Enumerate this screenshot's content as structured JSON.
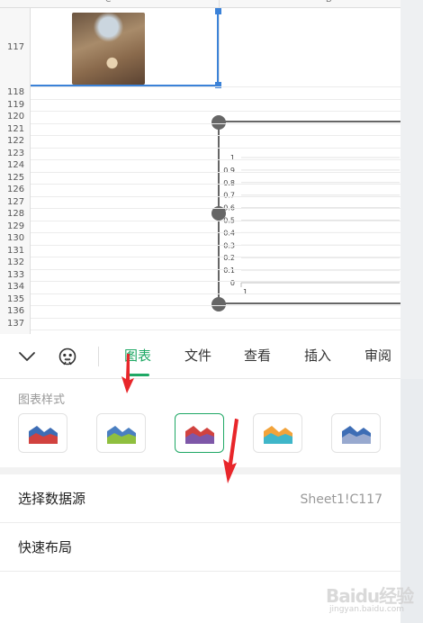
{
  "sheet": {
    "columns": [
      "C",
      "D"
    ],
    "rows": [
      "117",
      "118",
      "119",
      "120",
      "121",
      "122",
      "123",
      "124",
      "125",
      "126",
      "127",
      "128",
      "129",
      "130",
      "131",
      "132",
      "133",
      "134",
      "135",
      "136",
      "137"
    ],
    "selected_cell_image": "interior-photo"
  },
  "chart_preview": {
    "y_tick_labels": [
      "1",
      "0.9",
      "0.8",
      "0.7",
      "0.6",
      "0.5",
      "0.4",
      "0.3",
      "0.2",
      "0.1",
      "0"
    ],
    "x_tick_labels": [
      "1"
    ]
  },
  "toolbar": {
    "collapse_icon": "chevron-down-icon",
    "emoji_icon": "emoji-face-icon",
    "tabs": [
      {
        "label": "图表",
        "active": true
      },
      {
        "label": "文件",
        "active": false
      },
      {
        "label": "查看",
        "active": false
      },
      {
        "label": "插入",
        "active": false
      },
      {
        "label": "审阅",
        "active": false
      }
    ],
    "accent_color": "#1fa865"
  },
  "panel": {
    "section_title": "图表样式",
    "styles": [
      {
        "name": "area-style-1",
        "colors": [
          "#3d6db5",
          "#d1423f"
        ],
        "selected": false
      },
      {
        "name": "area-style-2",
        "colors": [
          "#4a7fc1",
          "#8fbf3f"
        ],
        "selected": false
      },
      {
        "name": "area-style-3",
        "colors": [
          "#d1423f",
          "#7e57a8"
        ],
        "selected": true
      },
      {
        "name": "area-style-4",
        "colors": [
          "#f2a33a",
          "#3fb6c9"
        ],
        "selected": false
      },
      {
        "name": "area-style-5",
        "colors": [
          "#3d6db5",
          "#98a9cf"
        ],
        "selected": false
      }
    ],
    "rows": [
      {
        "label": "选择数据源",
        "value": "Sheet1!C117"
      },
      {
        "label": "快速布局",
        "value": ""
      }
    ]
  },
  "watermark": {
    "text": "Baidu经验",
    "sub": "jingyan.baidu.com"
  },
  "annotation_color": "#e8262a"
}
